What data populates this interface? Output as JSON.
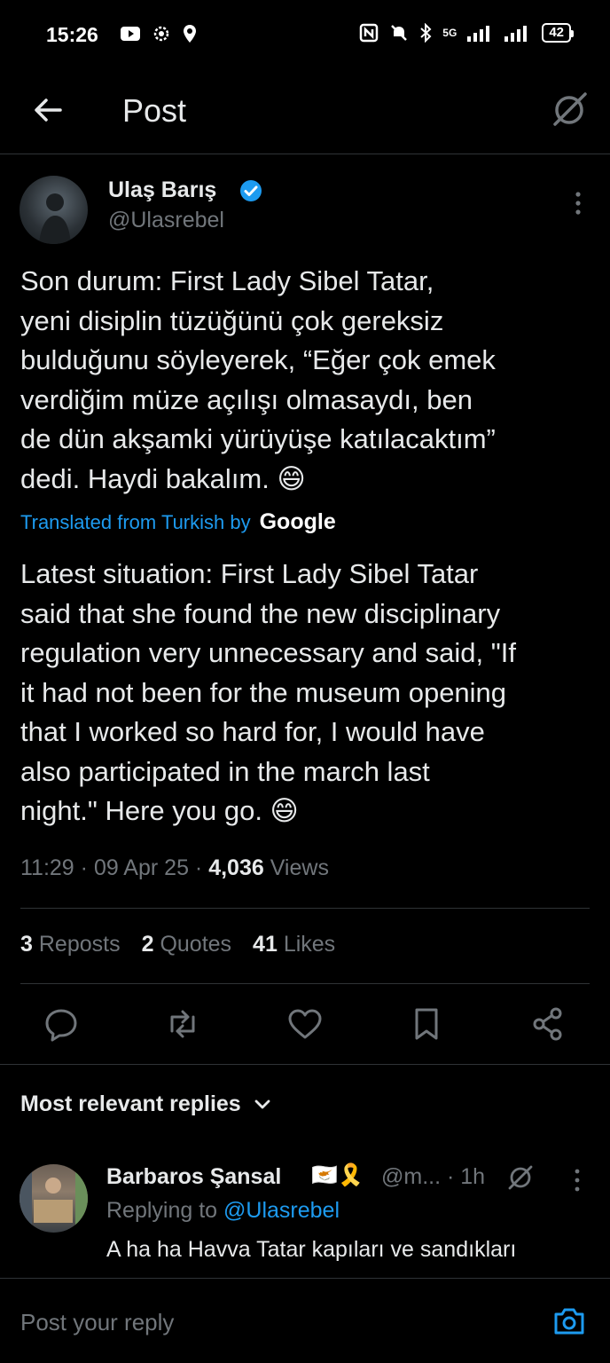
{
  "status_bar": {
    "time": "15:26",
    "battery": "42",
    "network": "5G"
  },
  "header": {
    "title": "Post"
  },
  "post": {
    "author_name": "Ulaş Barış",
    "author_handle": "@Ulasrebel",
    "text": "Son durum: First Lady Sibel Tatar,\nyeni disiplin tüzüğünü çok gereksiz\nbulduğunu söyleyerek, “Eğer çok emek\nverdiğim müze açılışı olmasaydı, ben\nde dün akşamki yürüyüşe katılacaktım”\ndedi. Haydi bakalım. 😄",
    "translated_label": "Translated from Turkish by",
    "translator": "Google",
    "translation": "Latest situation: First Lady Sibel Tatar\nsaid that she found the new disciplinary\nregulation very unnecessary and said, \"If\nit had not been for the museum opening\nthat I worked so hard for, I would have\nalso participated in the march last\nnight.\" Here you go. 😄",
    "time": "11:29",
    "date": "09 Apr 25",
    "views_count": "4,036",
    "views_label": "Views",
    "reposts_count": "3",
    "reposts_label": "Reposts",
    "quotes_count": "2",
    "quotes_label": "Quotes",
    "likes_count": "41",
    "likes_label": "Likes"
  },
  "replies_section": {
    "label": "Most relevant replies"
  },
  "reply": {
    "name": "Barbaros Şansal",
    "flags": "🇨🇾🎗️",
    "handle": "@m...",
    "time": "· 1h",
    "replying_prefix": "Replying to",
    "replying_handle": "@Ulasrebel",
    "text": "A ha ha Havva Tatar kapıları ve sandıkları"
  },
  "compose": {
    "placeholder": "Post your reply"
  },
  "colors": {
    "accent": "#1d9bf0",
    "background": "#000000",
    "secondary_text": "#71767b"
  }
}
